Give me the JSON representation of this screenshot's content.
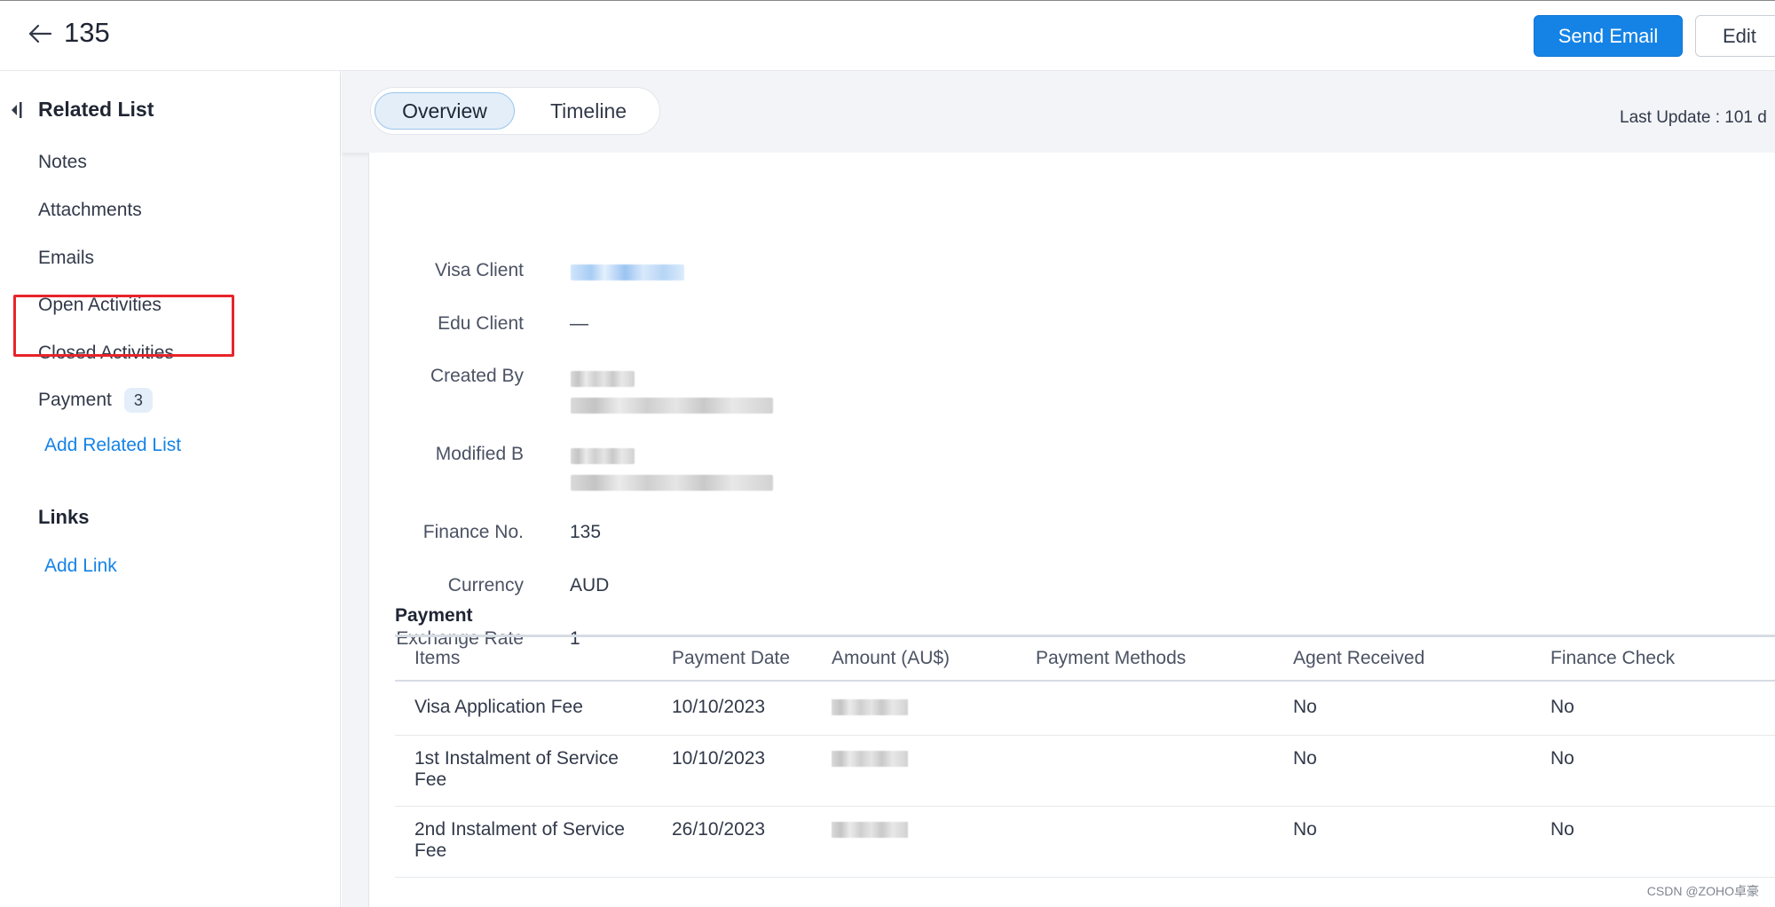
{
  "header": {
    "title": "135",
    "send_email_label": "Send Email",
    "edit_label": "Edit"
  },
  "sidebar": {
    "related_list_heading": "Related List",
    "items": [
      {
        "label": "Notes"
      },
      {
        "label": "Attachments"
      },
      {
        "label": "Emails"
      },
      {
        "label": "Open Activities"
      },
      {
        "label": "Closed Activities"
      },
      {
        "label": "Payment",
        "count": "3"
      }
    ],
    "add_related_list_label": "Add Related List",
    "links_heading": "Links",
    "add_link_label": "Add Link"
  },
  "tabs": [
    {
      "label": "Overview",
      "active": true
    },
    {
      "label": "Timeline",
      "active": false
    }
  ],
  "last_update": "Last Update : 101 d",
  "fields": {
    "visa_client": {
      "label": "Visa Client"
    },
    "edu_client": {
      "label": "Edu Client",
      "value": "—"
    },
    "created_by": {
      "label": "Created By"
    },
    "modified_by": {
      "label": "Modified B"
    },
    "finance_no": {
      "label": "Finance No.",
      "value": "135"
    },
    "currency": {
      "label": "Currency",
      "value": "AUD"
    },
    "exchange_rate": {
      "label": "Exchange Rate",
      "value": "1"
    }
  },
  "payment": {
    "title": "Payment",
    "columns": [
      "Items",
      "Payment Date",
      "Amount (AU$)",
      "Payment Methods",
      "Agent Received",
      "Finance Check"
    ],
    "rows": [
      {
        "item": "Visa Application Fee",
        "date": "10/10/2023",
        "method": "",
        "agent_received": "No",
        "finance_check": "No"
      },
      {
        "item": "1st Instalment of Service Fee",
        "date": "10/10/2023",
        "method": "",
        "agent_received": "No",
        "finance_check": "No"
      },
      {
        "item": "2nd Instalment of Service Fee",
        "date": "26/10/2023",
        "method": "",
        "agent_received": "No",
        "finance_check": "No"
      }
    ]
  },
  "watermark": "CSDN @ZOHO卓豪",
  "colors": {
    "accent": "#1583e6",
    "highlight_box": "#e8242b",
    "badge_bg": "#e3eef9"
  },
  "icons": {
    "back": "arrow-left-icon",
    "collapse": "collapse-panel-icon"
  }
}
